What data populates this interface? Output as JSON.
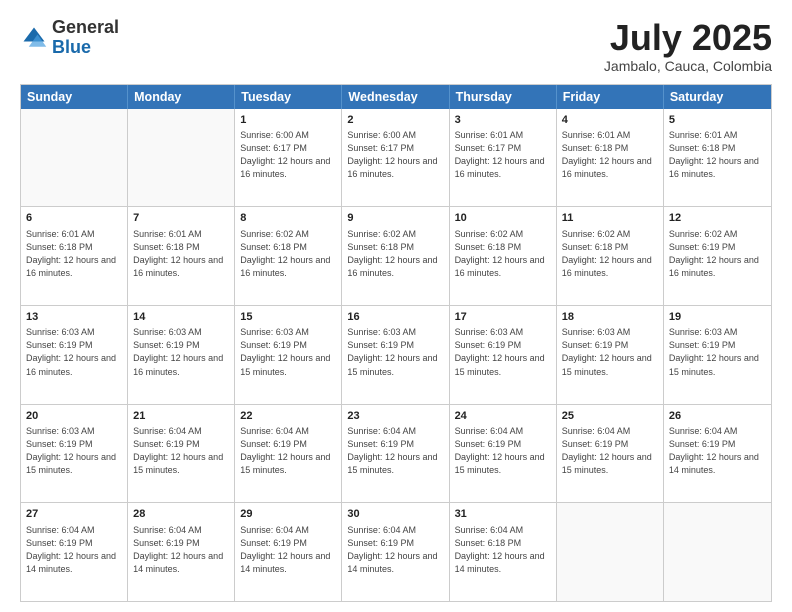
{
  "header": {
    "logo_general": "General",
    "logo_blue": "Blue",
    "month_title": "July 2025",
    "location": "Jambalo, Cauca, Colombia"
  },
  "days_of_week": [
    "Sunday",
    "Monday",
    "Tuesday",
    "Wednesday",
    "Thursday",
    "Friday",
    "Saturday"
  ],
  "weeks": [
    [
      {
        "day": "",
        "empty": true
      },
      {
        "day": "",
        "empty": true
      },
      {
        "day": "1",
        "sunrise": "Sunrise: 6:00 AM",
        "sunset": "Sunset: 6:17 PM",
        "daylight": "Daylight: 12 hours and 16 minutes."
      },
      {
        "day": "2",
        "sunrise": "Sunrise: 6:00 AM",
        "sunset": "Sunset: 6:17 PM",
        "daylight": "Daylight: 12 hours and 16 minutes."
      },
      {
        "day": "3",
        "sunrise": "Sunrise: 6:01 AM",
        "sunset": "Sunset: 6:17 PM",
        "daylight": "Daylight: 12 hours and 16 minutes."
      },
      {
        "day": "4",
        "sunrise": "Sunrise: 6:01 AM",
        "sunset": "Sunset: 6:18 PM",
        "daylight": "Daylight: 12 hours and 16 minutes."
      },
      {
        "day": "5",
        "sunrise": "Sunrise: 6:01 AM",
        "sunset": "Sunset: 6:18 PM",
        "daylight": "Daylight: 12 hours and 16 minutes."
      }
    ],
    [
      {
        "day": "6",
        "sunrise": "Sunrise: 6:01 AM",
        "sunset": "Sunset: 6:18 PM",
        "daylight": "Daylight: 12 hours and 16 minutes."
      },
      {
        "day": "7",
        "sunrise": "Sunrise: 6:01 AM",
        "sunset": "Sunset: 6:18 PM",
        "daylight": "Daylight: 12 hours and 16 minutes."
      },
      {
        "day": "8",
        "sunrise": "Sunrise: 6:02 AM",
        "sunset": "Sunset: 6:18 PM",
        "daylight": "Daylight: 12 hours and 16 minutes."
      },
      {
        "day": "9",
        "sunrise": "Sunrise: 6:02 AM",
        "sunset": "Sunset: 6:18 PM",
        "daylight": "Daylight: 12 hours and 16 minutes."
      },
      {
        "day": "10",
        "sunrise": "Sunrise: 6:02 AM",
        "sunset": "Sunset: 6:18 PM",
        "daylight": "Daylight: 12 hours and 16 minutes."
      },
      {
        "day": "11",
        "sunrise": "Sunrise: 6:02 AM",
        "sunset": "Sunset: 6:18 PM",
        "daylight": "Daylight: 12 hours and 16 minutes."
      },
      {
        "day": "12",
        "sunrise": "Sunrise: 6:02 AM",
        "sunset": "Sunset: 6:19 PM",
        "daylight": "Daylight: 12 hours and 16 minutes."
      }
    ],
    [
      {
        "day": "13",
        "sunrise": "Sunrise: 6:03 AM",
        "sunset": "Sunset: 6:19 PM",
        "daylight": "Daylight: 12 hours and 16 minutes."
      },
      {
        "day": "14",
        "sunrise": "Sunrise: 6:03 AM",
        "sunset": "Sunset: 6:19 PM",
        "daylight": "Daylight: 12 hours and 16 minutes."
      },
      {
        "day": "15",
        "sunrise": "Sunrise: 6:03 AM",
        "sunset": "Sunset: 6:19 PM",
        "daylight": "Daylight: 12 hours and 15 minutes."
      },
      {
        "day": "16",
        "sunrise": "Sunrise: 6:03 AM",
        "sunset": "Sunset: 6:19 PM",
        "daylight": "Daylight: 12 hours and 15 minutes."
      },
      {
        "day": "17",
        "sunrise": "Sunrise: 6:03 AM",
        "sunset": "Sunset: 6:19 PM",
        "daylight": "Daylight: 12 hours and 15 minutes."
      },
      {
        "day": "18",
        "sunrise": "Sunrise: 6:03 AM",
        "sunset": "Sunset: 6:19 PM",
        "daylight": "Daylight: 12 hours and 15 minutes."
      },
      {
        "day": "19",
        "sunrise": "Sunrise: 6:03 AM",
        "sunset": "Sunset: 6:19 PM",
        "daylight": "Daylight: 12 hours and 15 minutes."
      }
    ],
    [
      {
        "day": "20",
        "sunrise": "Sunrise: 6:03 AM",
        "sunset": "Sunset: 6:19 PM",
        "daylight": "Daylight: 12 hours and 15 minutes."
      },
      {
        "day": "21",
        "sunrise": "Sunrise: 6:04 AM",
        "sunset": "Sunset: 6:19 PM",
        "daylight": "Daylight: 12 hours and 15 minutes."
      },
      {
        "day": "22",
        "sunrise": "Sunrise: 6:04 AM",
        "sunset": "Sunset: 6:19 PM",
        "daylight": "Daylight: 12 hours and 15 minutes."
      },
      {
        "day": "23",
        "sunrise": "Sunrise: 6:04 AM",
        "sunset": "Sunset: 6:19 PM",
        "daylight": "Daylight: 12 hours and 15 minutes."
      },
      {
        "day": "24",
        "sunrise": "Sunrise: 6:04 AM",
        "sunset": "Sunset: 6:19 PM",
        "daylight": "Daylight: 12 hours and 15 minutes."
      },
      {
        "day": "25",
        "sunrise": "Sunrise: 6:04 AM",
        "sunset": "Sunset: 6:19 PM",
        "daylight": "Daylight: 12 hours and 15 minutes."
      },
      {
        "day": "26",
        "sunrise": "Sunrise: 6:04 AM",
        "sunset": "Sunset: 6:19 PM",
        "daylight": "Daylight: 12 hours and 14 minutes."
      }
    ],
    [
      {
        "day": "27",
        "sunrise": "Sunrise: 6:04 AM",
        "sunset": "Sunset: 6:19 PM",
        "daylight": "Daylight: 12 hours and 14 minutes."
      },
      {
        "day": "28",
        "sunrise": "Sunrise: 6:04 AM",
        "sunset": "Sunset: 6:19 PM",
        "daylight": "Daylight: 12 hours and 14 minutes."
      },
      {
        "day": "29",
        "sunrise": "Sunrise: 6:04 AM",
        "sunset": "Sunset: 6:19 PM",
        "daylight": "Daylight: 12 hours and 14 minutes."
      },
      {
        "day": "30",
        "sunrise": "Sunrise: 6:04 AM",
        "sunset": "Sunset: 6:19 PM",
        "daylight": "Daylight: 12 hours and 14 minutes."
      },
      {
        "day": "31",
        "sunrise": "Sunrise: 6:04 AM",
        "sunset": "Sunset: 6:18 PM",
        "daylight": "Daylight: 12 hours and 14 minutes."
      },
      {
        "day": "",
        "empty": true
      },
      {
        "day": "",
        "empty": true
      }
    ]
  ]
}
